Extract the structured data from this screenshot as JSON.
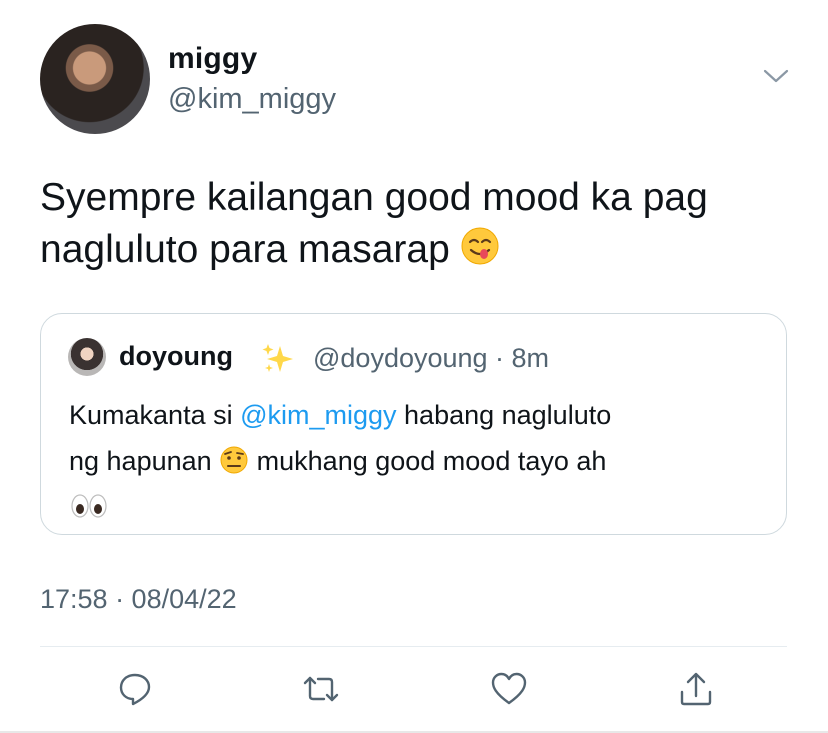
{
  "author": {
    "display_name": "miggy",
    "handle": "@kim_miggy"
  },
  "tweet": {
    "text_line1": "Syempre kailangan good mood ka pag",
    "text_line2": "nagluluto para masarap"
  },
  "quoted": {
    "display_name": "doyoung",
    "handle_time": "@doydoyoung · 8m",
    "text_before_mention": "Kumakanta si ",
    "mention": "@kim_miggy",
    "text_after_mention": " habang nagluluto",
    "text_line2_a": "ng hapunan ",
    "text_line2_b": " mukhang good mood tayo ah"
  },
  "timestamp": "17:58 · 08/04/22",
  "icons": {
    "more": "chevron-down-icon",
    "reply": "reply-icon",
    "retweet": "retweet-icon",
    "like": "heart-icon",
    "share": "share-icon"
  },
  "colors": {
    "text": "#0f1419",
    "secondary": "#536471",
    "mention": "#1d9bf0",
    "border": "#cfd9de"
  }
}
